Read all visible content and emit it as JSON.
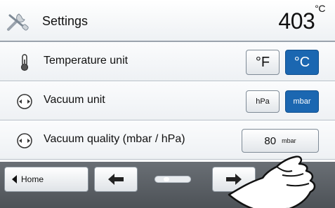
{
  "header": {
    "title": "Settings",
    "temperature": "403",
    "temperature_unit": "°C",
    "icon": "tools-icon"
  },
  "rows": [
    {
      "label": "Temperature unit",
      "icon": "thermometer-icon",
      "options": [
        "°F",
        "°C"
      ],
      "selected": "°C"
    },
    {
      "label": "Vacuum unit",
      "icon": "vacuum-icon",
      "options": [
        "hPa",
        "mbar"
      ],
      "selected": "mbar"
    },
    {
      "label": "Vacuum quality (mbar / hPa)",
      "icon": "vacuum-icon",
      "value": "80",
      "unit": "mbar"
    }
  ],
  "bottom": {
    "home_label": "Home",
    "back_icon": "arrow-left-icon",
    "forward_icon": "arrow-right-icon",
    "page_indicator_icon": "page-slider-icon"
  },
  "colors": {
    "accent": "#1b67b1",
    "bottom_bar": "#5a5f65"
  }
}
